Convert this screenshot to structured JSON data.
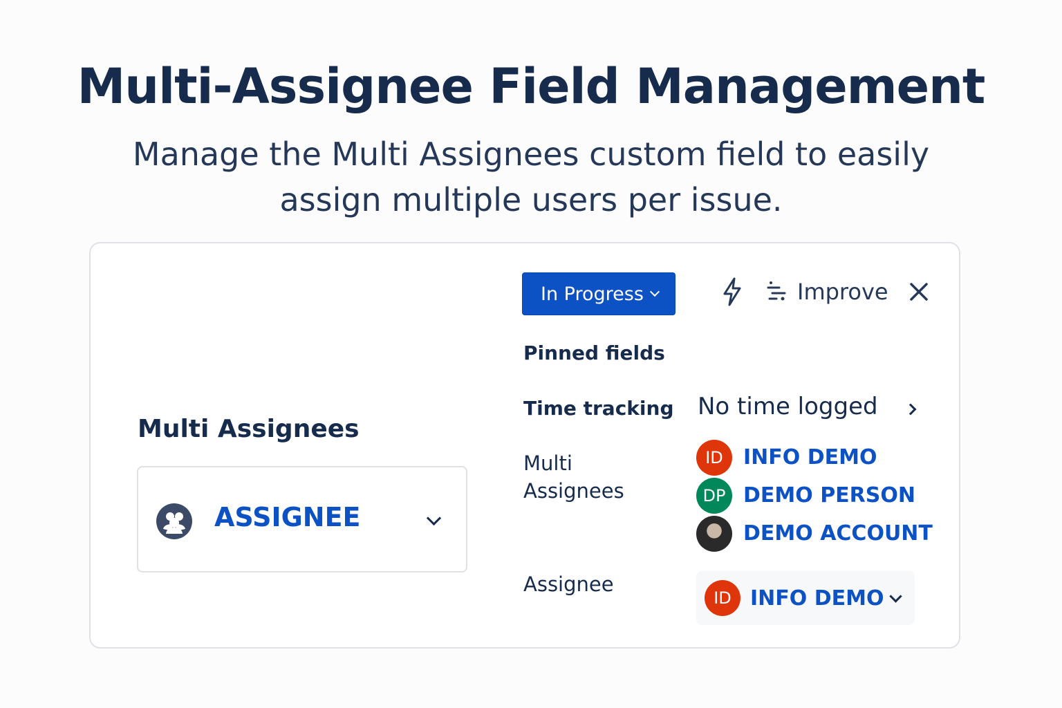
{
  "header": {
    "title": "Multi-Assignee Field Management",
    "subtitle": "Manage the Multi Assignees custom field to easily assign multiple users per issue."
  },
  "left_panel": {
    "field_label": "Multi Assignees",
    "select_value": "ASSIGNEE",
    "icon": "group-icon"
  },
  "toolbar": {
    "status_label": "In Progress",
    "bolt_icon": "bolt-icon",
    "improve_label": "Improve",
    "close_icon": "close-icon"
  },
  "details": {
    "pinned_heading": "Pinned fields",
    "time_tracking": {
      "label": "Time tracking",
      "value": "No time logged"
    },
    "multi_assignees": {
      "label": "Multi Assignees",
      "users": [
        {
          "initials": "ID",
          "name": "INFO DEMO",
          "color": "#de350b"
        },
        {
          "initials": "DP",
          "name": "DEMO PERSON",
          "color": "#00875a"
        },
        {
          "initials": "",
          "name": "DEMO ACCOUNT",
          "color": "#222222"
        }
      ]
    },
    "assignee": {
      "label": "Assignee",
      "user": {
        "initials": "ID",
        "name": "INFO DEMO",
        "color": "#de350b"
      }
    }
  },
  "colors": {
    "primary": "#0c52c4",
    "text": "#172b4d",
    "border": "#dfe1e6"
  }
}
